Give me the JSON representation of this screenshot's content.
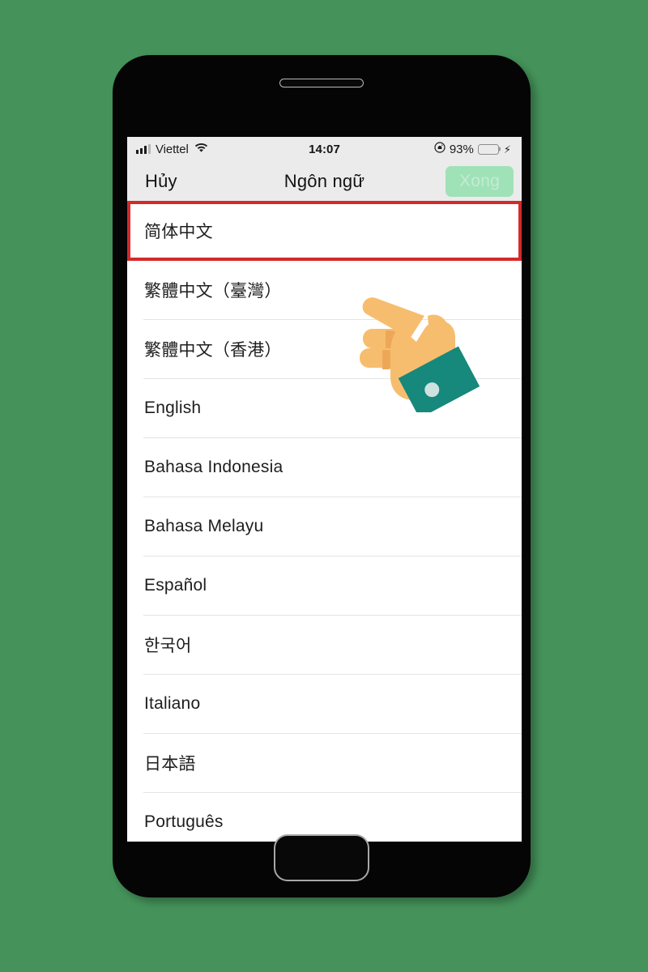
{
  "background": {
    "color": "#45935b"
  },
  "device": {
    "name": "smartphone-mockup",
    "earpiece": "earpiece-speaker",
    "home_button": "home-button"
  },
  "status_bar": {
    "carrier": "Viettel",
    "signal_icon": "signal-bars-icon",
    "wifi_icon": "wifi-icon",
    "time": "14:07",
    "rotation_lock_icon": "rotation-lock-icon",
    "battery_percent": "93%",
    "battery_level": 93,
    "battery_color": "#41d15e",
    "charging_icon": "charging-bolt-icon"
  },
  "nav_bar": {
    "cancel_label": "Hủy",
    "title": "Ngôn ngữ",
    "done_label": "Xong",
    "done_enabled": false,
    "done_bg": "#9fe2b8",
    "done_text_color": "#c4ebd2"
  },
  "highlight": {
    "color": "#d42a2a",
    "target_index": 0
  },
  "languages": [
    {
      "label": "简体中文",
      "script": "cjk",
      "highlighted": true
    },
    {
      "label": "繁體中文（臺灣）",
      "script": "cjk",
      "highlighted": false
    },
    {
      "label": "繁體中文（香港）",
      "script": "cjk",
      "highlighted": false
    },
    {
      "label": "English",
      "script": "latin",
      "highlighted": false
    },
    {
      "label": "Bahasa Indonesia",
      "script": "latin",
      "highlighted": false
    },
    {
      "label": "Bahasa Melayu",
      "script": "latin",
      "highlighted": false
    },
    {
      "label": "Español",
      "script": "latin",
      "highlighted": false
    },
    {
      "label": "한국어",
      "script": "cjk",
      "highlighted": false
    },
    {
      "label": "Italiano",
      "script": "latin",
      "highlighted": false
    },
    {
      "label": "日本語",
      "script": "cjk",
      "highlighted": false
    },
    {
      "label": "Português",
      "script": "latin",
      "highlighted": false
    }
  ],
  "pointer": {
    "icon": "pointing-hand-icon",
    "skin_color": "#f7bd6e",
    "cuff_color": "#16887c",
    "button_color": "#cfe2df"
  }
}
